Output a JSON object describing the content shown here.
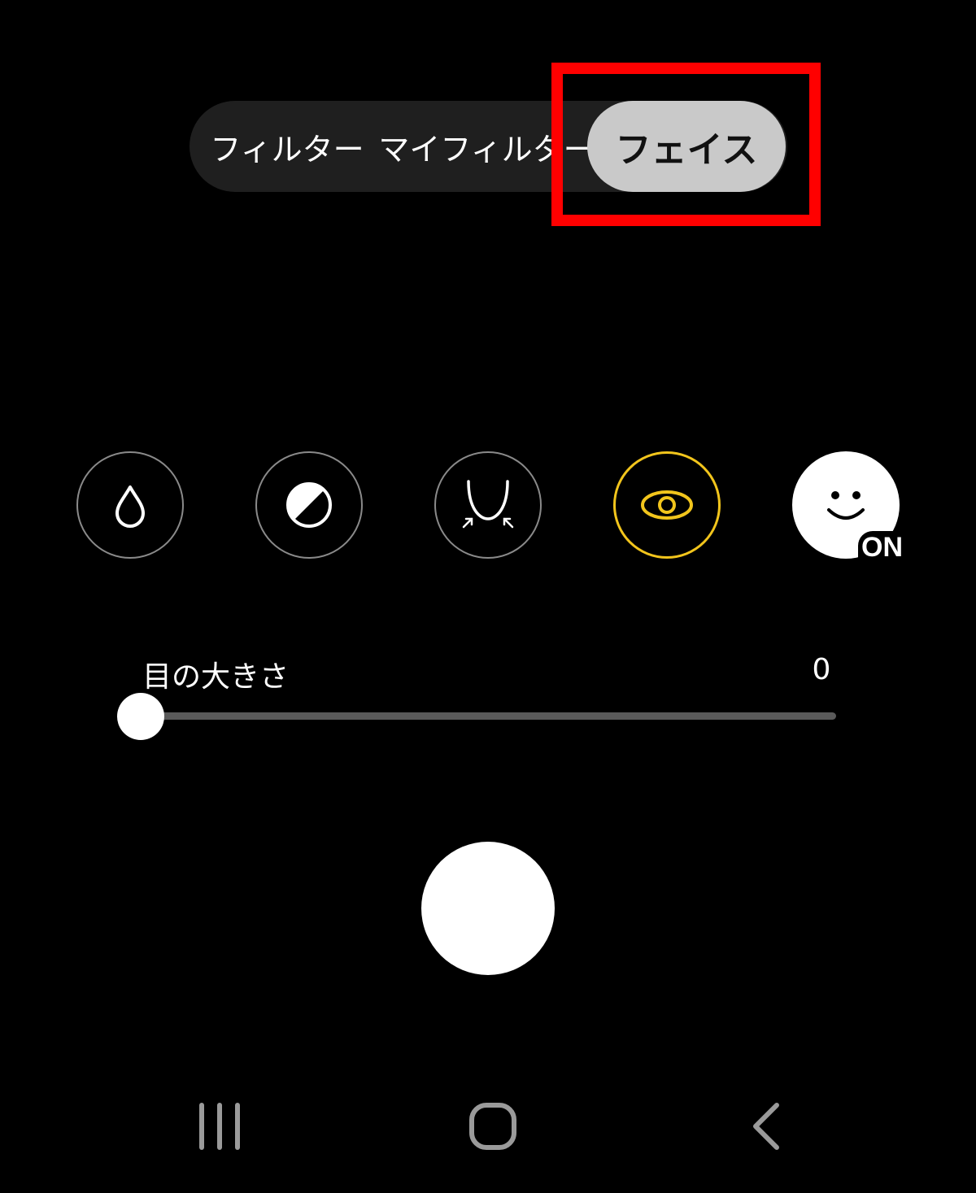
{
  "tabs": [
    {
      "label": "フィルター",
      "selected": false
    },
    {
      "label": "マイフィルター",
      "selected": false
    },
    {
      "label": "フェイス",
      "selected": true
    }
  ],
  "beauty_icons": [
    {
      "icon": "droplet-icon",
      "selected": false
    },
    {
      "icon": "tone-half-circle-icon",
      "selected": false
    },
    {
      "icon": "face-slim-icon",
      "selected": false
    },
    {
      "icon": "eye-icon",
      "selected": true
    },
    {
      "icon": "smiley-face-icon",
      "selected": false,
      "badge": "ON"
    }
  ],
  "slider": {
    "label": "目の大きさ",
    "value": "0",
    "fraction": 0
  },
  "colors": {
    "highlight": "#ff0000",
    "selected_ring": "#f2c51c",
    "selected_tab_bg": "#c9c9c9"
  },
  "nav": {
    "recents": "recents-icon",
    "home": "home-icon",
    "back": "back-icon"
  }
}
